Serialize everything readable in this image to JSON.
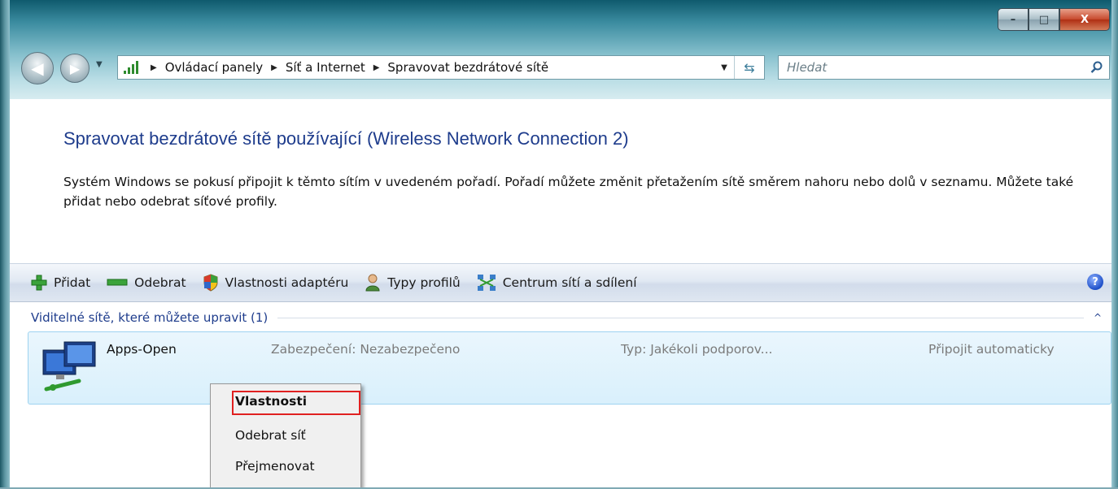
{
  "window": {
    "controls": {
      "minimize": "–",
      "maximize": "□",
      "close": "X"
    }
  },
  "navigation": {
    "breadcrumbs": [
      "Ovládací panely",
      "Síť a Internet",
      "Spravovat bezdrátové sítě"
    ],
    "search_placeholder": "Hledat"
  },
  "page": {
    "title": "Spravovat bezdrátové sítě používající (Wireless Network Connection 2)",
    "description": "Systém Windows se pokusí připojit k těmto sítím v uvedeném pořadí. Pořadí můžete změnit přetažením sítě směrem nahoru nebo dolů v seznamu. Můžete také přidat nebo odebrat síťové profily."
  },
  "toolbar": {
    "add": "Přidat",
    "remove": "Odebrat",
    "adapter_properties": "Vlastnosti adaptéru",
    "profile_types": "Typy profilů",
    "network_center": "Centrum sítí a sdílení",
    "help": "?"
  },
  "group": {
    "label": "Viditelné sítě, které můžete upravit (1)",
    "collapse": "^"
  },
  "networks": [
    {
      "name": "Apps-Open",
      "security": "Zabezpečení: Nezabezpečeno",
      "type": "Typ: Jakékoli podporov...",
      "connection": "Připojit automaticky"
    }
  ],
  "context_menu": {
    "items": [
      "Vlastnosti",
      "Odebrat síť",
      "Přejmenovat"
    ],
    "highlight_color": "#e02020"
  },
  "icons": [
    "signal-bars-icon",
    "add-icon",
    "remove-icon",
    "shield-icon",
    "users-icon",
    "network-center-icon",
    "help-icon",
    "wireless-computer-icon",
    "search-icon",
    "refresh-icon"
  ]
}
